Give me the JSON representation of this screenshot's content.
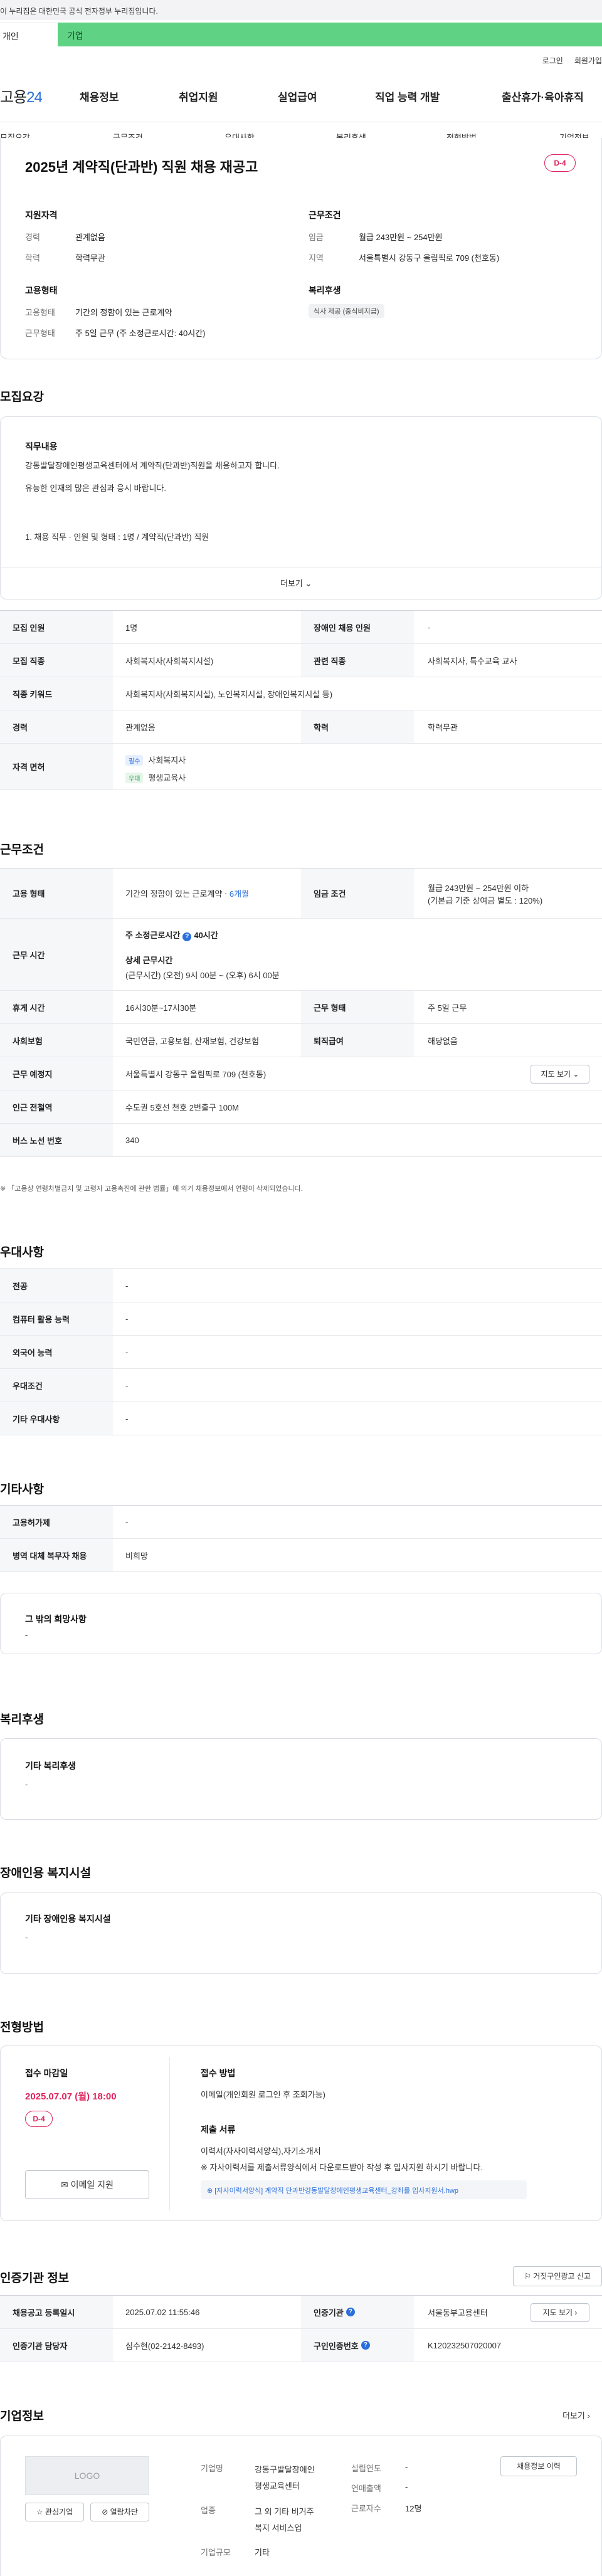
{
  "gov_banner": "이 누리집은 대한민국 공식 전자정부 누리집입니다.",
  "user_tabs": [
    "개인",
    "기업"
  ],
  "util": [
    "로그인",
    "회원가입"
  ],
  "logo": {
    "prefix": "고용",
    "suffix": "24"
  },
  "gnb": [
    "채용정보",
    "취업지원",
    "실업급여",
    "직업 능력 개발",
    "출산휴가·육아휴직"
  ],
  "subnav": [
    "모집요강",
    "근무조건",
    "우대사항",
    "복리후생",
    "전형방법",
    "기업정보"
  ],
  "job": {
    "title": "2025년 계약직(단과반) 직원 채용 재공고",
    "dday": "D-4"
  },
  "summary": {
    "qual_title": "지원자격",
    "career_l": "경력",
    "career_v": "관계없음",
    "edu_l": "학력",
    "edu_v": "학력무관",
    "cond_title": "근무조건",
    "wage_l": "임금",
    "wage_v": "월급 243만원 ~ 254만원",
    "loc_l": "지역",
    "loc_v": "서울특별시 강동구 올림픽로 709 (천호동)",
    "emp_title": "고용형태",
    "type_l": "고용형태",
    "type_v": "기간의 정함이 있는 근로계약",
    "hours_l": "근무형태",
    "hours_v": "주 5일 근무 (주 소정근로시간: 40시간)",
    "welfare_title": "복리후생",
    "welfare_chip": "식사 제공 (중식비지급)"
  },
  "recruit": {
    "section": "모집요강",
    "duty_title": "직무내용",
    "duty_line1": "강동발달장애인평생교육센터에서 계약직(단과반)직원을 채용하고자 합니다.",
    "duty_line2": "유능한 인재의 많은 관심과 응시 바랍니다.",
    "duty_line3": "1. 채용 직무 · 인원 및 형태 : 1명 / 계약직(단과반) 직원",
    "more": "더보기",
    "count_l": "모집 인원",
    "count_v": "1명",
    "disabled_l": "장애인 채용 인원",
    "disabled_v": "-",
    "job_l": "모집 직종",
    "job_v": "사회복지사(사회복지시설)",
    "rel_l": "관련 직종",
    "rel_v": "사회복지사, 특수교육 교사",
    "kw_l": "직종 키워드",
    "kw_v": "사회복지사(사회복지시설), 노인복지시설, 장애인복지시설 등)",
    "career_l": "경력",
    "career_v": "관계없음",
    "edu_l": "학력",
    "edu_v": "학력무관",
    "license_l": "자격 면허",
    "lic1_tag": "필수",
    "lic1": "사회복지사",
    "lic2_tag": "우대",
    "lic2": "평생교육사"
  },
  "work": {
    "section": "근무조건",
    "emp_l": "고용 형태",
    "emp_v": "기간의 정함이 있는 근로계약",
    "emp_v2": "6개월",
    "wage_l": "임금 조건",
    "wage_v": "월급 243만원 ~ 254만원 이하",
    "wage_v2": "(기본급 기준 상여금 별도 : 120%)",
    "time_l": "근무 시간",
    "time_weekly": "주 소정근로시간",
    "time_weekly_v": "40시간",
    "time_detail": "상세 근무시간",
    "time_detail_v": "(근무시간) (오전) 9시 00분 ~ (오후) 6시 00분",
    "rest_l": "휴게 시간",
    "rest_v": "16시30분~17시30분",
    "form_l": "근무 형태",
    "form_v": "주 5일 근무",
    "ins_l": "사회보험",
    "ins_v": "국민연금, 고용보험, 산재보험, 건강보험",
    "ret_l": "퇴직급여",
    "ret_v": "해당없음",
    "place_l": "근무 예정지",
    "place_v": "서울특별시 강동구 올림픽로 709 (천호동)",
    "map_btn": "지도 보기",
    "sub_l": "인근 전철역",
    "sub_v": "수도권 5호선 천호 2번출구 100M",
    "bus_l": "버스 노선 번호",
    "bus_v": "340",
    "note": "※ 「고용상 연령차별금지 및 고령자 고용촉진에 관한 법률」에 의거 채용정보에서 연령이 삭제되었습니다."
  },
  "pref": {
    "section": "우대사항",
    "rows": [
      {
        "l": "전공",
        "v": "-"
      },
      {
        "l": "컴퓨터 활용 능력",
        "v": "-"
      },
      {
        "l": "외국어 능력",
        "v": "-"
      },
      {
        "l": "우대조건",
        "v": "-"
      },
      {
        "l": "기타 우대사항",
        "v": "-"
      }
    ]
  },
  "etc": {
    "section": "기타사항",
    "rows": [
      {
        "l": "고용허가제",
        "v": "-"
      },
      {
        "l": "병역 대체 복무자 채용",
        "v": "비희망"
      }
    ],
    "other_title": "그 밖의 희망사항",
    "other_v": "-"
  },
  "welfare": {
    "section": "복리후생",
    "title": "기타 복리후생",
    "v": "-"
  },
  "facility": {
    "section": "장애인용 복지시설",
    "title": "기타 장애인용 복지시설",
    "v": "-"
  },
  "select": {
    "section": "전형방법",
    "deadline_title": "접수 마감일",
    "deadline_v": "2025.07.07 (월) 18:00",
    "dday": "D-4",
    "apply_btn": "이메일 지원",
    "method_title": "접수 방법",
    "method_v": "이메일(개인회원 로그인 후 조회가능)",
    "docs_title": "제출 서류",
    "docs_v1": "이력서(자사이력서양식),자기소개서",
    "docs_v2": "※ 자사이력서를 제출서류양식에서 다운로드받아 작성 후 입사지원 하시기 바랍니다.",
    "file": "[자사이력서양식] 계약직 단과반강동발달장애인평생교육센터_강좌를 입사지원서.hwp"
  },
  "agency": {
    "section": "인증기관 정보",
    "report_btn": "거짓구인광고 신고",
    "reg_l": "채용공고 등록일시",
    "reg_v": "2025.07.02 11:55:46",
    "inst_l": "인증기관",
    "inst_v": "서울동부고용센터",
    "map_btn": "지도 보기",
    "mgr_l": "인증기관 담당자",
    "mgr_v": "심수현(02-2142-8493)",
    "num_l": "구인인증번호",
    "num_v": "K120232507020007"
  },
  "company": {
    "section": "기업정보",
    "more": "더보기",
    "logo": "LOGO",
    "fav_btn": "관심기업",
    "block_btn": "열람차단",
    "name_l": "기업명",
    "name_v1": "강동구발달장애인",
    "name_v2": "평생교육센터",
    "biz_l": "업종",
    "biz_v1": "그 외 기타 비거주",
    "biz_v2": "복지 서비스업",
    "size_l": "기업규모",
    "size_v": "기타",
    "est_l": "설립연도",
    "est_v": "-",
    "sales_l": "연매출액",
    "sales_v": "-",
    "emp_l": "근로자수",
    "emp_v": "12명",
    "jobs_btn": "채용정보 이력"
  }
}
